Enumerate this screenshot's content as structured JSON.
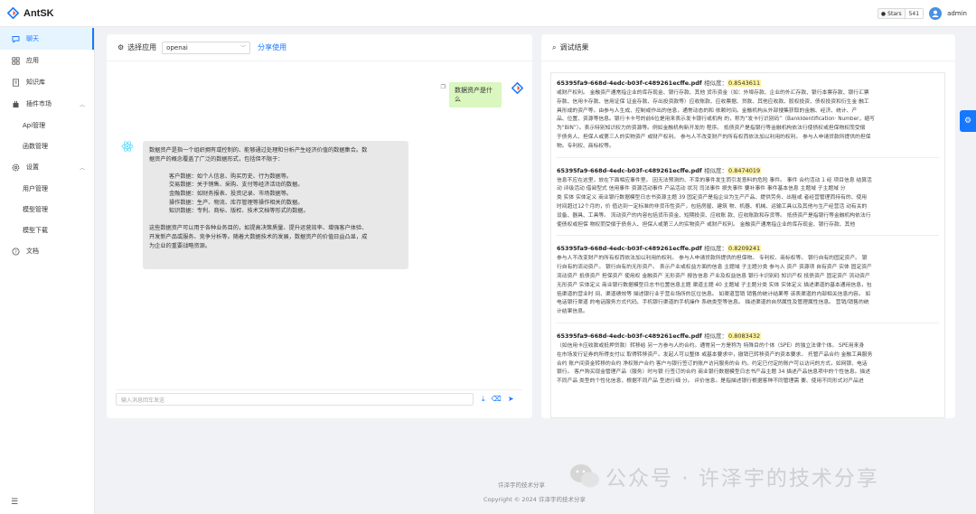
{
  "app": {
    "name": "AntSK"
  },
  "header": {
    "stars_label": "Stars",
    "stars_count": "541",
    "user": "admin"
  },
  "sidebar": {
    "items": [
      {
        "label": "聊天",
        "icon": "message-icon"
      },
      {
        "label": "应用",
        "icon": "appstore-icon"
      },
      {
        "label": "知识库",
        "icon": "book-icon"
      },
      {
        "label": "插件市场",
        "icon": "plugin-icon"
      },
      {
        "label": "Api管理"
      },
      {
        "label": "函数管理"
      },
      {
        "label": "设置",
        "icon": "setting-icon"
      },
      {
        "label": "用户管理"
      },
      {
        "label": "模型管理"
      },
      {
        "label": "模型下载"
      },
      {
        "label": "文档",
        "icon": "question-icon"
      }
    ]
  },
  "chat": {
    "select_label": "选择应用",
    "selected_app": "openai",
    "share_label": "分享使用",
    "user_message": "数据资产是什么",
    "bot_lines": [
      "数据资产是指一个组织拥有或控制的、能够通过处理和分析产生经济价值的数据集合。数",
      "据资产的概念覆盖了广泛的数据形式，包括但不限于：",
      "客户数据：如个人信息、购买历史、行为数据等。",
      "交易数据：关于销售、采购、支付等经济活动的数据。",
      "金融数据：如财务报表、投资记录、市场数据等。",
      "操作数据：生产、物流、库存管理等操作相关的数据。",
      "知识数据：专利、商标、版权、技术文档等形式的数据。",
      "这些数据资产可以用于各种业务目的，如提高决策质量、提升运营效率、增强客户体验、",
      "开发新产品或服务、竞争分析等。随着大数据技术的发展，数据资产的价值日益凸显，成",
      "为企业的重要战略资源。"
    ],
    "input_placeholder": "输入消息回车发送"
  },
  "debug": {
    "title": "调试结果",
    "sim_label": "相似度：",
    "results": [
      {
        "file": "65395fa9-668d-4edc-b03f-c489261ecffe.pdf",
        "score": "0.8543611",
        "lines": [
          "或财产权利。 金融资产通常指企业的库存现金、银行存款、其他 货币资金（如：外埠存款、企业的外汇存款、银行本票存款、银行汇票",
          "存款、信用卡存款、信用证保 证金存款、存出投资款等）应收账款、应收票据、贷款、其他应收款、股权投资、债权投资和衍生金 融工",
          "具形成的资产等。由参与人生成、控制或作出的信息，通常动态的和 依赖时间。金融机构从外部搜集获取的金融、经济、统计、产",
          "品、位置、资源等信息。银行卡卡号的前6位是用来表示发卡银行或机构 的，称为“发卡行识别码”（BankIdentification· Number，缩写",
          "为“BIN”）。表示特别知识权力的资源等。例如金融机构新开发的 程序。 抵债资产是指银行等金融机构依法行使债权或担保物权而受偿",
          "于债务人、担保人或第三人的实物资产 或财产权利。 参与人不改变财产的所有权而依法加以利用的权利。 参与人申请贷款所提供的担保",
          "物。专利权、商标权等。"
        ]
      },
      {
        "file": "65395fa9-668d-4edc-b03f-c489261ecffe.pdf",
        "score": "0.8474019",
        "lines": [
          "信息不应在这里，放在下面相应事件里。 因无法预测的、不幸的事件发生而引发意料的危险 事件。 事件 合约活动 1 经 项目信息 结算活",
          "动 评级活动 借阅型式 信用事件 资源活动事件 产品活动 状况 司法事件 损失事件 要补事件 事件基本信息 主题域 子主题域 分",
          "类 实体 实体定义 商业银行数据模型日志书资源主题 39 固定资产是指企业为生产产品、提供劳务、出租或 者经营管理而持有的、使用",
          "时间超过12个月的，价 值达到一定标准的非货币性资产，包括房屋、建筑 物、机器、机械、运输工具以及其他与生产经营活 动有关的",
          "设备、器具、工具等。 流动资产的内容包括货币资金、短期投资、应收账 款、应收账款和存货等。 抵债资产是指银行等金融机构依法行",
          "使债权或担保 物权而受偿于债务人、担保人或第三人的实物资产 或财产权利。 金融资产通常指企业的库存现金、银行存款、其他"
        ]
      },
      {
        "file": "65395fa9-668d-4edc-b03f-c489261ecffe.pdf",
        "score": "0.8209241",
        "lines": [
          "参与人不改变财产的所有权而依法加以利用的权利。 参与人申请贷款所提供的担保物。 专利权、商标权等。 银行自有的固定资产。 银",
          "行自有的流动资产。 银行自有的无形资产。 表示产业或权益方面的信息 主题域 子主题分类 参与人 资产 资源项 自有资产 实体 固定资产",
          "流动资产 抵债资产 担保资产 使用权 金融资产 无形资产 报告信息 产业及权益信息 银行卡识别码 知识产权 抵债资产 固定资产 流动资产",
          "无形资产 实体定义 商业银行数据模型日志书位置信息主题 渠道主题 40 主题域 子主题分类 实体 实体定义 描述渠道的基本通用信息，包",
          "括渠道的营业时 间、渠道绩效等 描述银行业于营业场所的区位信息。 如渠道营销 销售的统计结果等 该表渠道的内部相关信息内容。 如",
          "电话银行渠道 的电话服务方式代码、手机银行渠道的手机操作 系统类型等信息。 描述渠道的自然属性及管理属性信息。 营销/销售的统",
          "计结果信息。"
        ]
      },
      {
        "file": "65395fa9-668d-4edc-b03f-c489261ecffe.pdf",
        "score": "0.8083432",
        "lines": [
          "（如信用卡应收款或抵押贷款）转移给 另一方参与人的合约。通常另一方是称为 特殊目的个体（SPE）的独立法律个体。 SPE用来身",
          "在市场发行证券的所得支付以 取得转移资产。发起人可以整体 或基本要求中，撤销已转移资产的资本要求。 托管产品合约 金融工具服务",
          "合约 账户间资金转移的合约 净权账户合约 客户与银行签订的账户访问服务的合 约。约定已付定的账户可以访问的方式，如网银、电话",
          "银行。 客户购买现金管理产品（服务）时与银 行签订的合约 商业银行数据模型日志书产品主题 34 描述产品信息项中的个性信息。描述",
          "不同产品 类型的个性化信息，根据不同产品 型进行细 分。 评价信息。是指描述银行根据客种不同管理需 要、使用不同形式对产品进"
        ]
      }
    ]
  },
  "footer": {
    "line1": "许泽宇的技术分享",
    "line2": "Copyright © 2024 许泽宇的技术分享"
  },
  "watermark": {
    "text": "公众号 · 许泽宇的技术分享"
  }
}
